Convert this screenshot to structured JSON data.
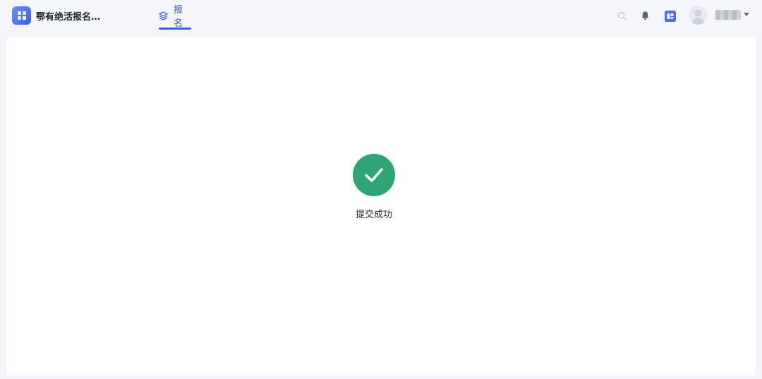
{
  "app": {
    "title": "鄂有绝活报名…",
    "logo_icon": "window-grid-icon",
    "accent": "#3d5bd9"
  },
  "nav": {
    "tabs": [
      {
        "label": "报名",
        "icon": "layers-icon",
        "active": true
      }
    ]
  },
  "toolbar": {
    "search_icon": "search-icon",
    "bell_icon": "bell-icon",
    "app_icon": "app-square-icon",
    "user_name": "■■■■"
  },
  "result": {
    "icon": "check-icon",
    "status_color": "#2ea575",
    "message": "提交成功"
  }
}
